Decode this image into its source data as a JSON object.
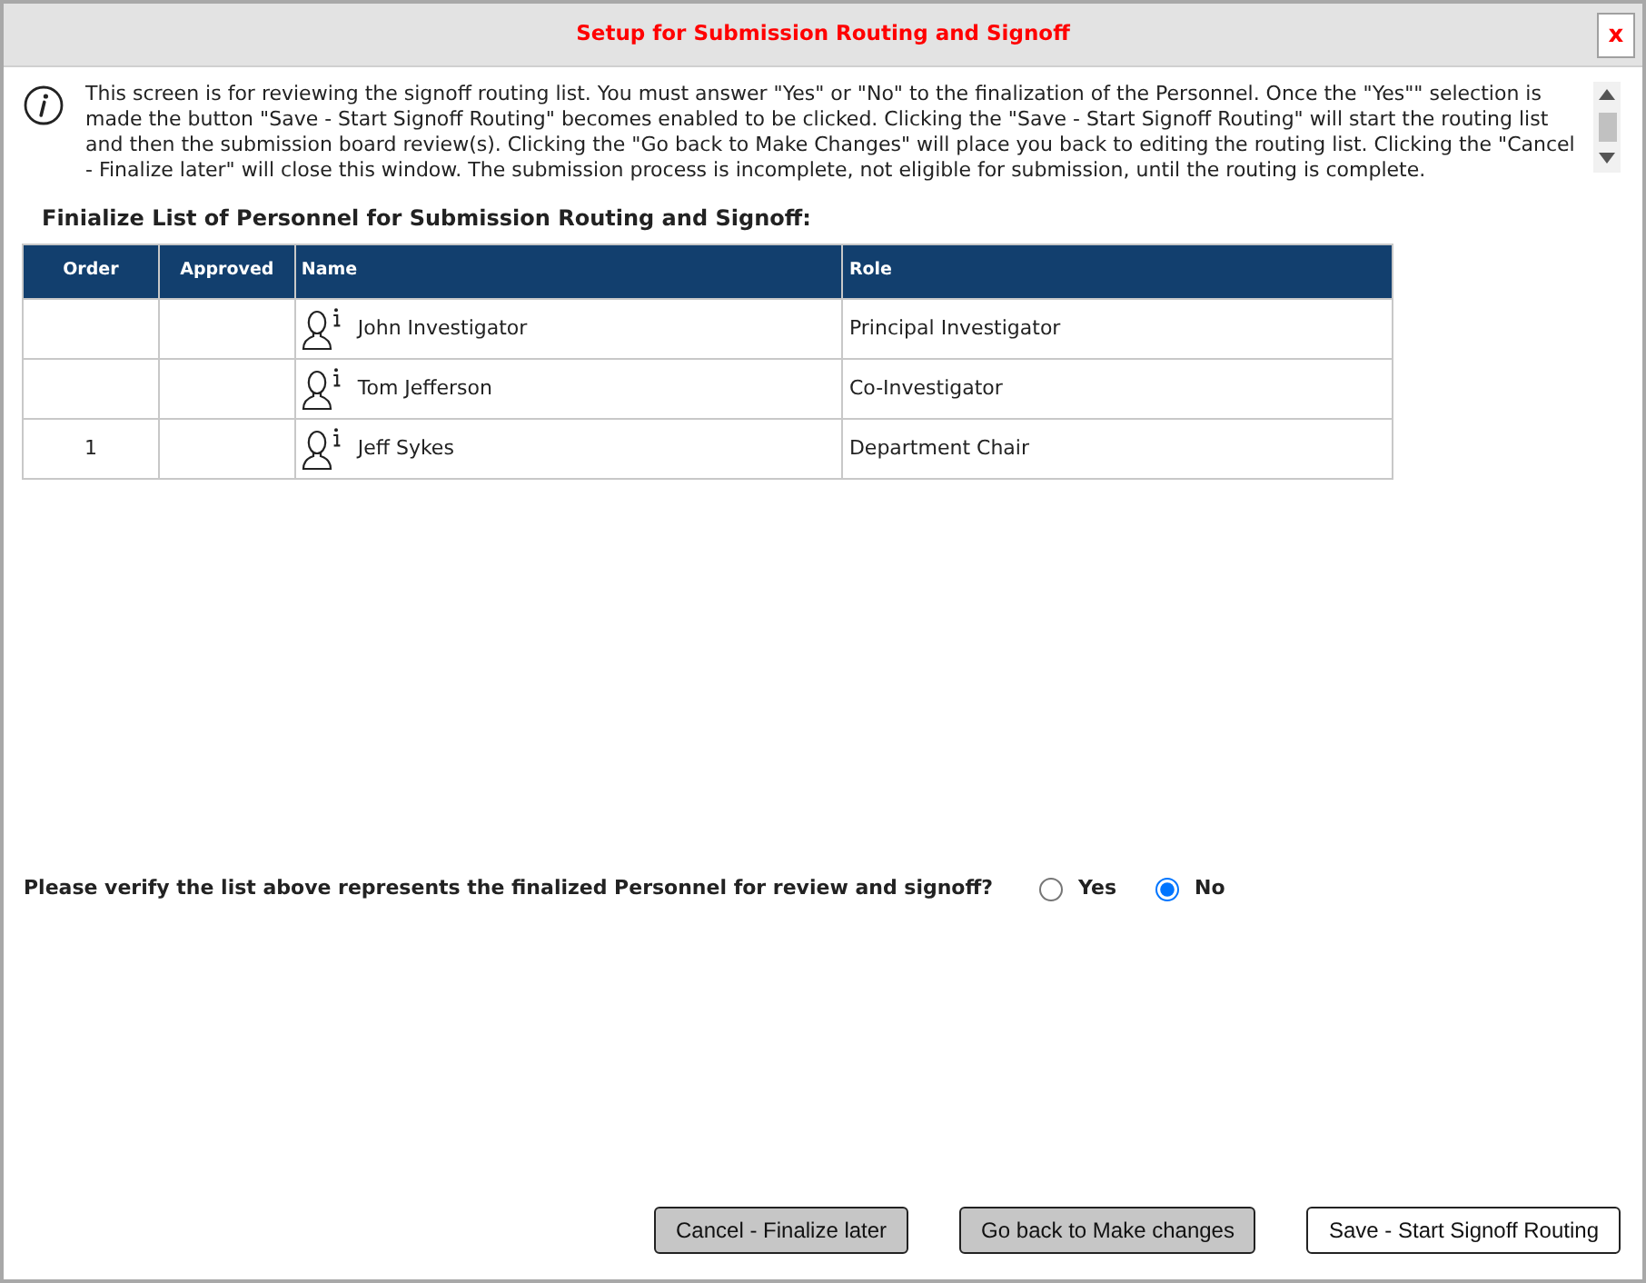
{
  "window": {
    "title": "Setup for Submission Routing and Signoff",
    "close_label": "x"
  },
  "info": {
    "text": "This screen is for reviewing the signoff routing list. You must answer \"Yes\" or \"No\" to the finalization of the Personnel. Once the \"Yes\"\" selection is made the button \"Save - Start Signoff Routing\" becomes enabled to be clicked. Clicking the \"Save - Start Signoff Routing\" will start the routing list and then the submission board review(s). Clicking the \"Go back to Make Changes\" will place you back to editing the routing list. Clicking the \"Cancel - Finalize later\" will close this window. The submission process is incomplete, not eligible for submission, until the routing is complete."
  },
  "section_title": "Finialize List of Personnel for Submission Routing and Signoff:",
  "table": {
    "columns": [
      "Order",
      "Approved",
      "Name",
      "Role"
    ],
    "rows": [
      {
        "name": "John Investigator",
        "role": "Principal Investigator"
      },
      {
        "name": "Tom Jefferson",
        "role": "Co-Investigator"
      },
      {
        "order": "1",
        "name": "Jeff Sykes",
        "role": "Department Chair"
      }
    ]
  },
  "question": {
    "text": "Please verify the list above represents the finalized Personnel for review and signoff?",
    "options": [
      {
        "label": "Yes",
        "selected": false
      },
      {
        "label": "No",
        "selected": true
      }
    ]
  },
  "buttons": [
    {
      "label": "Cancel - Finalize later",
      "kind": "secondary"
    },
    {
      "label": "Go back to Make changes",
      "kind": "secondary"
    },
    {
      "label": "Save - Start Signoff Routing",
      "kind": "plain"
    }
  ]
}
